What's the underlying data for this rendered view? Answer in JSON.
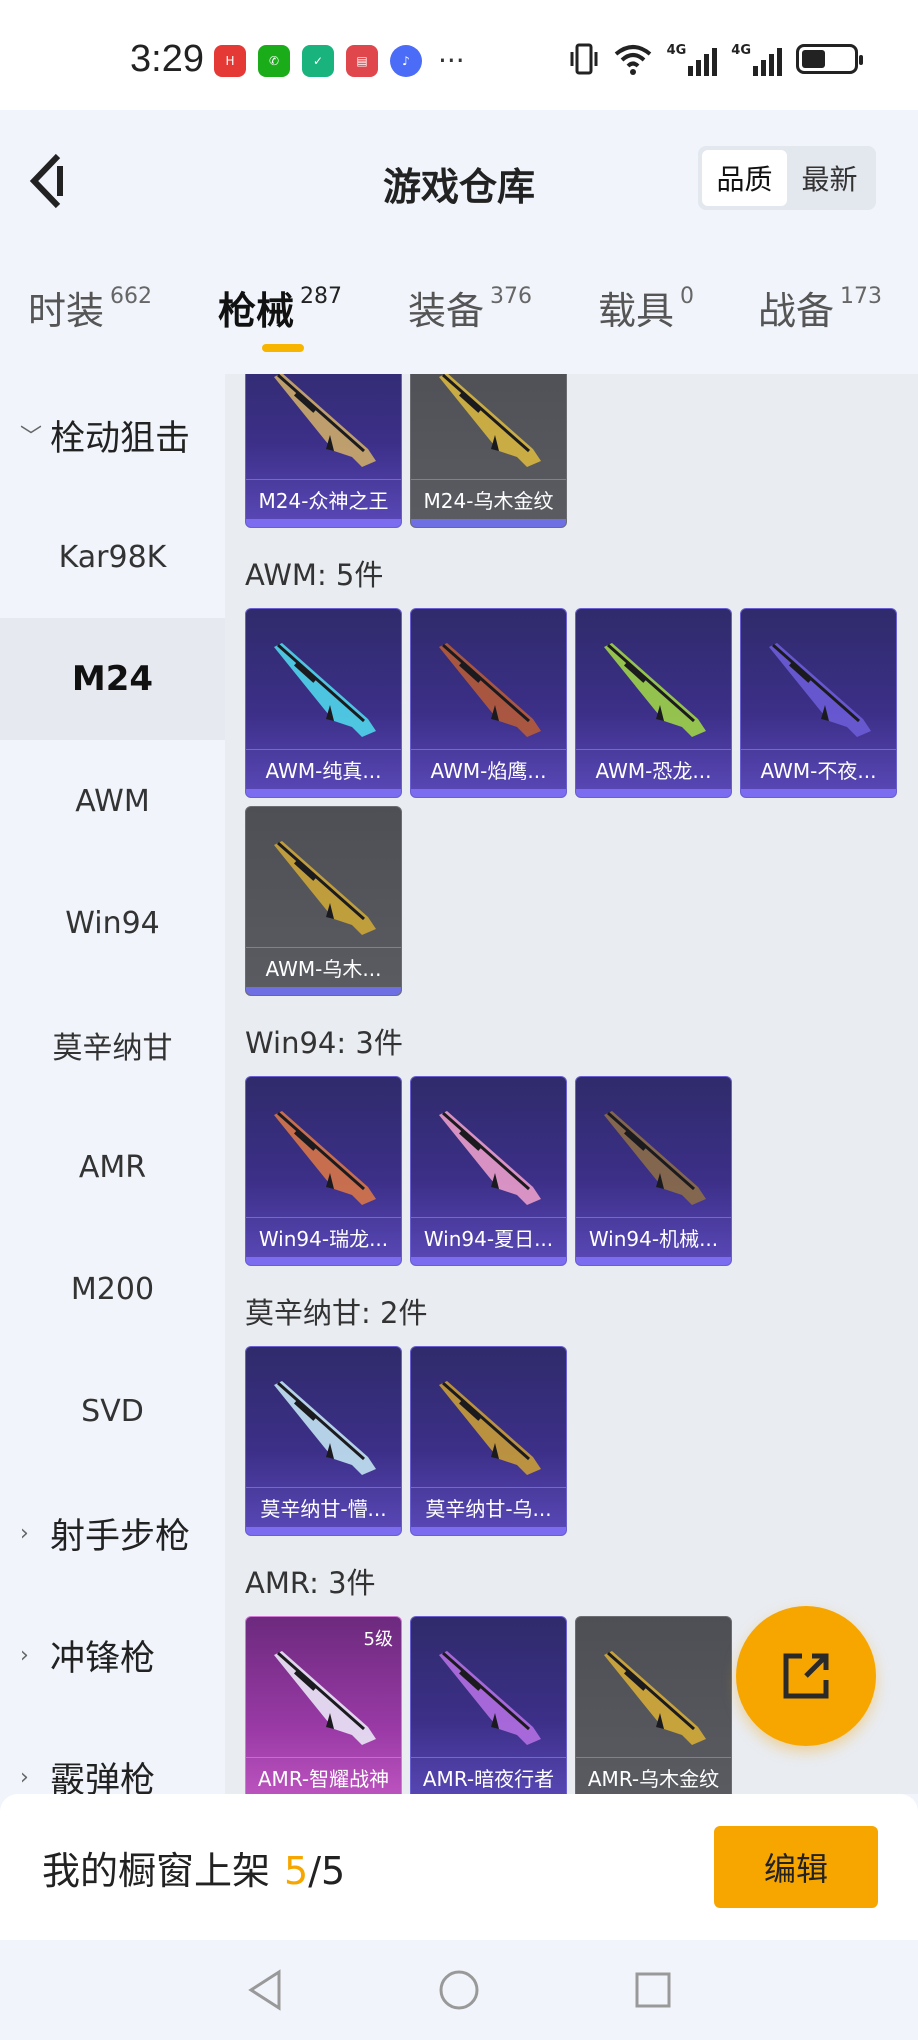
{
  "status_bar": {
    "time": "3:29",
    "apps": [
      {
        "icon": "huawei-icon",
        "color": "#e53935"
      },
      {
        "icon": "wechat-icon",
        "color": "#1aad19"
      },
      {
        "icon": "check-shield-icon",
        "color": "#19b37d"
      },
      {
        "icon": "book-icon",
        "color": "#e0474c"
      },
      {
        "icon": "music-icon",
        "color": "#4a6cf7"
      }
    ],
    "more": "···",
    "network": [
      "4G",
      "4G"
    ]
  },
  "header": {
    "title": "游戏仓库",
    "sort_options": [
      "品质",
      "最新"
    ],
    "active_sort": "品质"
  },
  "tabs": [
    {
      "label": "时装",
      "count": "662"
    },
    {
      "label": "枪械",
      "count": "287",
      "active": true
    },
    {
      "label": "装备",
      "count": "376"
    },
    {
      "label": "载具",
      "count": "0"
    },
    {
      "label": "战备",
      "count": "173"
    }
  ],
  "sidebar": {
    "items": [
      {
        "label": "栓动狙击",
        "type": "group",
        "expanded": true
      },
      {
        "label": "Kar98K"
      },
      {
        "label": "M24",
        "active": true
      },
      {
        "label": "AWM"
      },
      {
        "label": "Win94"
      },
      {
        "label": "莫辛纳甘"
      },
      {
        "label": "AMR"
      },
      {
        "label": "M200"
      },
      {
        "label": "SVD"
      },
      {
        "label": "射手步枪",
        "type": "group"
      },
      {
        "label": "冲锋枪",
        "type": "group"
      },
      {
        "label": "霰弹枪",
        "type": "group"
      }
    ]
  },
  "sections": [
    {
      "label": "",
      "items": [
        {
          "name": "M24-众神之王",
          "rarity": "purple",
          "gun_color": "#c9a86a"
        },
        {
          "name": "M24-乌木金纹",
          "rarity": "grey",
          "gun_color": "#d4b341"
        }
      ]
    },
    {
      "label": "AWM: 5件",
      "items": [
        {
          "name": "AWM-纯真...",
          "rarity": "purple",
          "gun_color": "#4fd1e8"
        },
        {
          "name": "AWM-焰鹰...",
          "rarity": "purple",
          "gun_color": "#b35a3c"
        },
        {
          "name": "AWM-恐龙...",
          "rarity": "purple",
          "gun_color": "#9ccf4a"
        },
        {
          "name": "AWM-不夜...",
          "rarity": "purple",
          "gun_color": "#6a5bd6"
        },
        {
          "name": "AWM-乌木...",
          "rarity": "grey",
          "gun_color": "#c9a43a"
        }
      ]
    },
    {
      "label": "Win94: 3件",
      "items": [
        {
          "name": "Win94-瑞龙...",
          "rarity": "purple",
          "gun_color": "#d2744a"
        },
        {
          "name": "Win94-夏日...",
          "rarity": "purple",
          "gun_color": "#e59ac8"
        },
        {
          "name": "Win94-机械...",
          "rarity": "purple",
          "gun_color": "#8a6b4a"
        }
      ]
    },
    {
      "label": "莫辛纳甘: 2件",
      "items": [
        {
          "name": "莫辛纳甘-懵...",
          "rarity": "purple",
          "gun_color": "#bfe0f0"
        },
        {
          "name": "莫辛纳甘-乌...",
          "rarity": "purple",
          "gun_color": "#c49a3a"
        }
      ]
    },
    {
      "label": "AMR: 3件",
      "items": [
        {
          "name": "AMR-智耀战神",
          "rarity": "legend",
          "gun_color": "#e8e2f4",
          "level": "5级"
        },
        {
          "name": "AMR-暗夜行者",
          "rarity": "purple",
          "gun_color": "#b06ee0"
        },
        {
          "name": "AMR-乌木金纹",
          "rarity": "grey",
          "gun_color": "#d1a93a"
        }
      ]
    }
  ],
  "share_button": {
    "icon": "share-icon",
    "color": "#f7a600"
  },
  "bottom": {
    "showcase_label": "我的橱窗上架",
    "current": "5",
    "separator": "/",
    "total": "5",
    "edit_label": "编辑"
  },
  "nav": [
    "back-nav-icon",
    "home-nav-icon",
    "recents-nav-icon"
  ]
}
